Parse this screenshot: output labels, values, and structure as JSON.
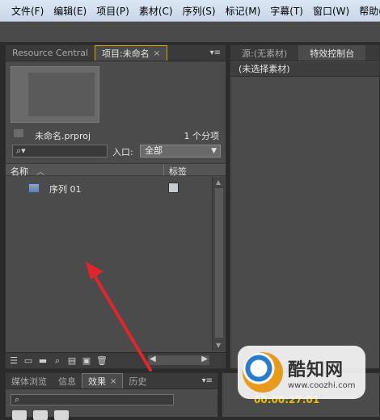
{
  "menubar": {
    "items": [
      "文件(F)",
      "编辑(E)",
      "项目(P)",
      "素材(C)",
      "序列(S)",
      "标记(M)",
      "字幕(T)",
      "窗口(W)",
      "帮助(H)"
    ]
  },
  "project_panel": {
    "tabs": [
      {
        "label": "Resource Central"
      },
      {
        "label": "项目:未命名",
        "close": "×"
      }
    ],
    "menu_icon": "▾≡",
    "project_name": "未命名.prproj",
    "item_count": "1 个分项",
    "search_placeholder": "",
    "entry_label": "入口:",
    "entry_value": "全部",
    "columns": {
      "name": "名称",
      "label": "标签"
    },
    "items": [
      {
        "name": "序列 01",
        "icon": "sequence-icon",
        "label_color": "#c8ccd0"
      }
    ]
  },
  "source_panel": {
    "tabs": [
      {
        "label": "源:(无素材)"
      },
      {
        "label": "特效控制台"
      }
    ],
    "no_clip_text": "(未选择素材)"
  },
  "effects_panel": {
    "tabs": [
      {
        "label": "媒体浏览"
      },
      {
        "label": "信息"
      },
      {
        "label": "效果",
        "close": "×"
      },
      {
        "label": "历史"
      }
    ],
    "menu_icon": "▾≡"
  },
  "timeline": {
    "timecode": "00:00:27:01"
  },
  "watermark": {
    "title": "酷知网",
    "url": "www.coozhi.com"
  },
  "colors": {
    "panel_bg": "#4b4b4b",
    "active_tab_border": "#d9a400",
    "arrow": "#e0262c",
    "timecode": "#e8c000"
  }
}
